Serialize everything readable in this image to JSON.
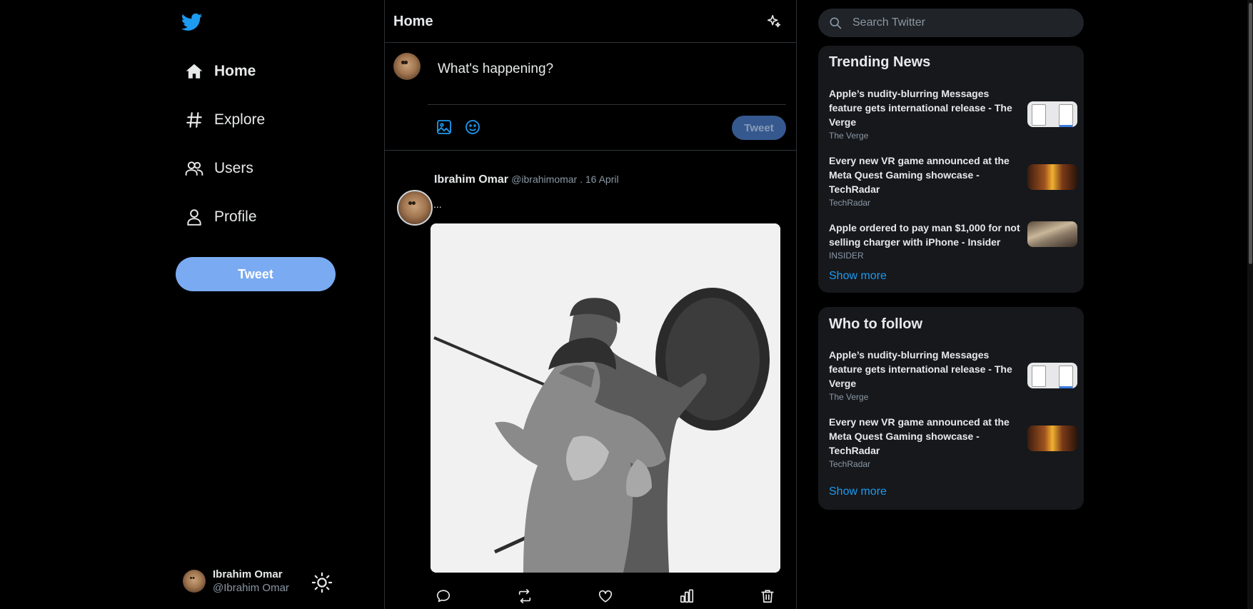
{
  "sidebar": {
    "nav": [
      {
        "label": "Home",
        "icon": "home-icon",
        "active": true
      },
      {
        "label": "Explore",
        "icon": "hashtag-icon",
        "active": false
      },
      {
        "label": "Users",
        "icon": "users-icon",
        "active": false
      },
      {
        "label": "Profile",
        "icon": "user-icon",
        "active": false
      }
    ],
    "tweet_button": "Tweet",
    "user": {
      "name": "Ibrahim Omar",
      "handle": "@Ibrahim Omar"
    }
  },
  "main": {
    "title": "Home",
    "compose": {
      "placeholder": "What's happening?",
      "tweet_button": "Tweet"
    },
    "post": {
      "name": "Ibrahim Omar",
      "meta": "@ibrahimomar . 16 April",
      "text": "..."
    }
  },
  "right": {
    "search_placeholder": "Search Twitter",
    "trending": {
      "title": "Trending News",
      "items": [
        {
          "title": "Apple’s nudity-blurring Messages feature gets international release - The Verge",
          "source": "The Verge"
        },
        {
          "title": "Every new VR game announced at the Meta Quest Gaming showcase - TechRadar",
          "source": "TechRadar"
        },
        {
          "title": "Apple ordered to pay man $1,000 for not selling charger with iPhone - Insider",
          "source": "INSIDER"
        }
      ],
      "show_more": "Show more"
    },
    "follow": {
      "title": "Who to follow",
      "items": [
        {
          "title": "Apple’s nudity-blurring Messages feature gets international release - The Verge",
          "source": "The Verge"
        },
        {
          "title": "Every new VR game announced at the Meta Quest Gaming showcase - TechRadar",
          "source": "TechRadar"
        }
      ],
      "show_more": "Show more"
    }
  },
  "colors": {
    "accent": "#1d9bf0",
    "background": "#000000",
    "panel": "#16181c",
    "tweet_button": "#7aabf2"
  }
}
